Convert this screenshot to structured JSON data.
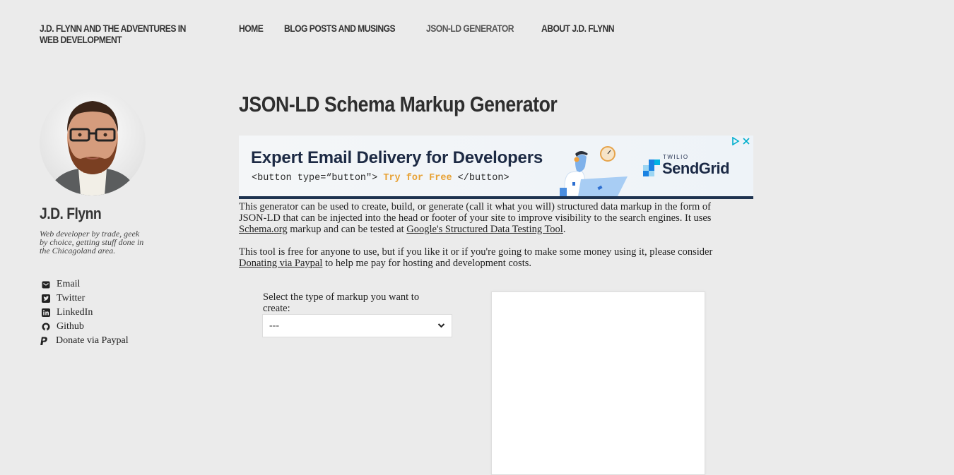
{
  "site": {
    "title": "J.D. FLYNN AND THE ADVENTURES IN WEB DEVELOPMENT"
  },
  "nav": {
    "items": [
      {
        "label": "HOME",
        "active": false
      },
      {
        "label": "BLOG POSTS AND MUSINGS",
        "active": false
      },
      {
        "label": "JSON-LD GENERATOR",
        "active": true
      },
      {
        "label": "ABOUT J.D. FLYNN",
        "active": false
      }
    ]
  },
  "sidebar": {
    "avatar_alt": "J.D. Flynn portrait",
    "name": "J.D. Flynn",
    "bio": "Web developer by trade, geek by choice, getting stuff done in the Chicagoland area.",
    "links": [
      {
        "icon": "email-icon",
        "label": "Email"
      },
      {
        "icon": "twitter-icon",
        "label": "Twitter"
      },
      {
        "icon": "linkedin-icon",
        "label": "LinkedIn"
      },
      {
        "icon": "github-icon",
        "label": "Github"
      },
      {
        "icon": "paypal-icon",
        "label": "Donate via Paypal"
      }
    ]
  },
  "main": {
    "title": "JSON-LD Schema Markup Generator",
    "ad": {
      "headline": "Expert Email Delivery for Developers",
      "code_open": "<button type=“button\">",
      "cta": "Try for Free",
      "code_close": "</button>",
      "brand_small": "TWILIO",
      "brand": "SendGrid",
      "colors": {
        "headline": "#1d2a44",
        "cta": "#e8a235",
        "bar": "#1e3350",
        "choices": "#00aecd"
      }
    },
    "intro": {
      "p1_a": "This generator can be used to create, build, or generate (call it what you will) structured data markup in the form of JSON-LD that can be injected into the head or footer of your site to improve visibility to the search engines. It uses ",
      "p1_link1": "Schema.org",
      "p1_b": " markup and can be tested at ",
      "p1_link2": "Google's Structured Data Testing Tool",
      "p1_c": ".",
      "p2_a": "This tool is free for anyone to use, but if you like it or if you're going to make some money using it, please consider ",
      "p2_link": "Donating via Paypal",
      "p2_b": " to help me pay for hosting and development costs."
    },
    "form": {
      "label": "Select the type of markup you want to create:",
      "selected": "---"
    },
    "output": {
      "value": ""
    }
  }
}
